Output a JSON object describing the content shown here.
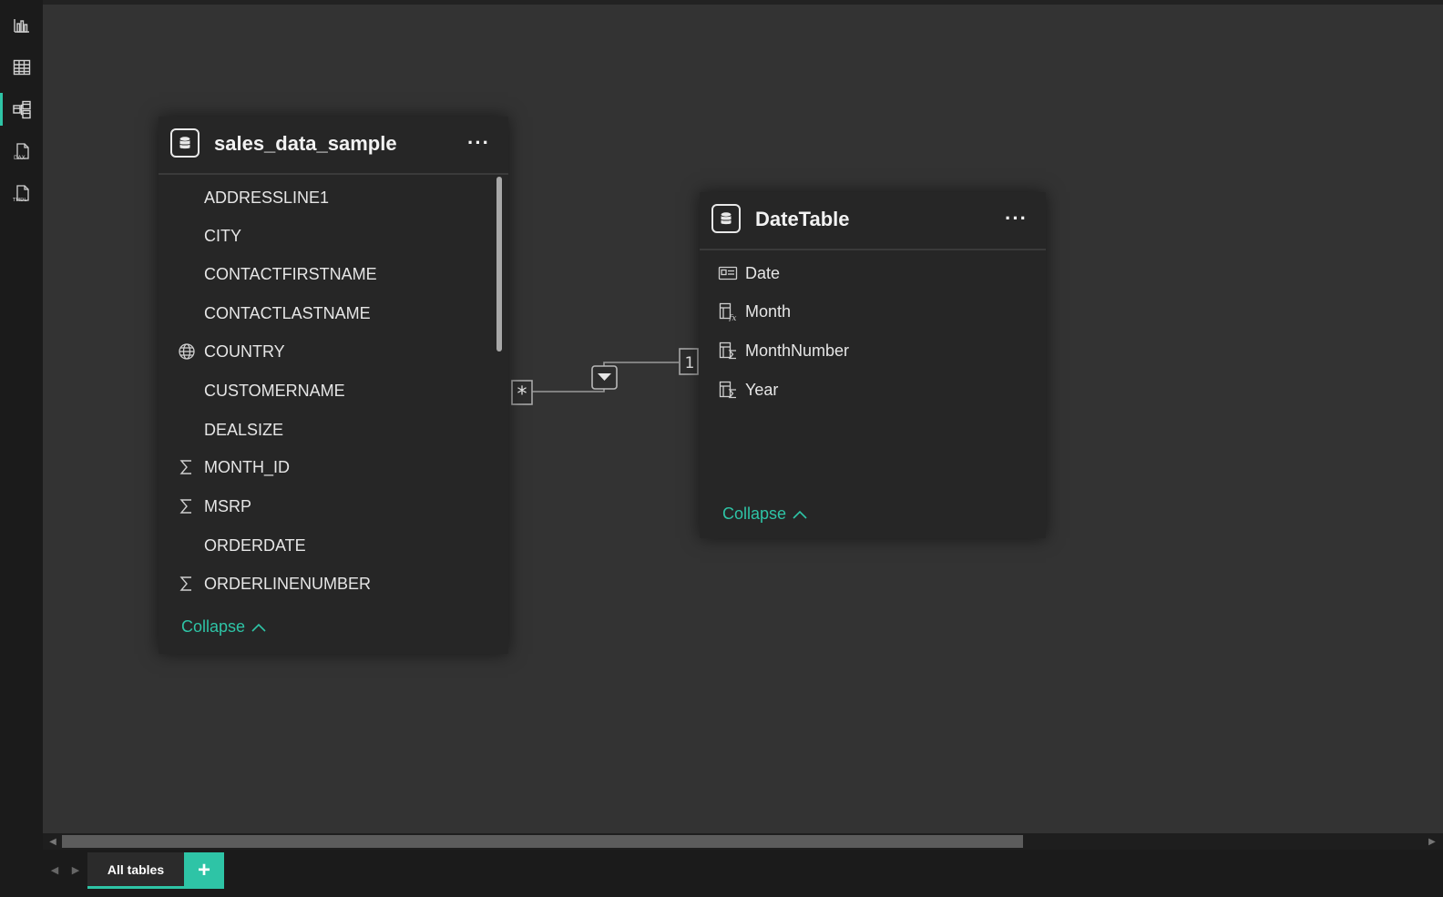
{
  "rail": {
    "items": [
      {
        "name": "report-view",
        "icon": "bar-chart-icon"
      },
      {
        "name": "table-view",
        "icon": "table-grid-icon"
      },
      {
        "name": "model-view",
        "icon": "model-icon",
        "active": true
      },
      {
        "name": "dax-query-view",
        "icon": "dax-icon"
      },
      {
        "name": "tmdl-view",
        "icon": "tmdl-icon"
      }
    ]
  },
  "tables": [
    {
      "title": "sales_data_sample",
      "more_label": "···",
      "fields": [
        {
          "label": "ADDRESSLINE1",
          "icon": ""
        },
        {
          "label": "CITY",
          "icon": ""
        },
        {
          "label": "CONTACTFIRSTNAME",
          "icon": ""
        },
        {
          "label": "CONTACTLASTNAME",
          "icon": ""
        },
        {
          "label": "COUNTRY",
          "icon": "globe-icon"
        },
        {
          "label": "CUSTOMERNAME",
          "icon": ""
        },
        {
          "label": "DEALSIZE",
          "icon": ""
        },
        {
          "label": "MONTH_ID",
          "icon": "sigma-icon"
        },
        {
          "label": "MSRP",
          "icon": "sigma-icon"
        },
        {
          "label": "ORDERDATE",
          "icon": ""
        },
        {
          "label": "ORDERLINENUMBER",
          "icon": "sigma-icon"
        }
      ],
      "collapse_label": "Collapse"
    },
    {
      "title": "DateTable",
      "more_label": "···",
      "fields": [
        {
          "label": "Date",
          "icon": "calendar-column-icon"
        },
        {
          "label": "Month",
          "icon": "calculated-column-icon"
        },
        {
          "label": "MonthNumber",
          "icon": "calculated-sigma-column-icon"
        },
        {
          "label": "Year",
          "icon": "calculated-sigma-column-icon"
        }
      ],
      "collapse_label": "Collapse"
    }
  ],
  "relationship": {
    "from_cardinality": "*",
    "to_cardinality": "1",
    "filter_direction": "single"
  },
  "bottom_tabs": {
    "tabs": [
      "All tables"
    ],
    "add_label": "+"
  },
  "colors": {
    "accent": "#2ec4a6",
    "canvas": "#333333",
    "card": "#262626",
    "rail": "#1b1b1b"
  }
}
